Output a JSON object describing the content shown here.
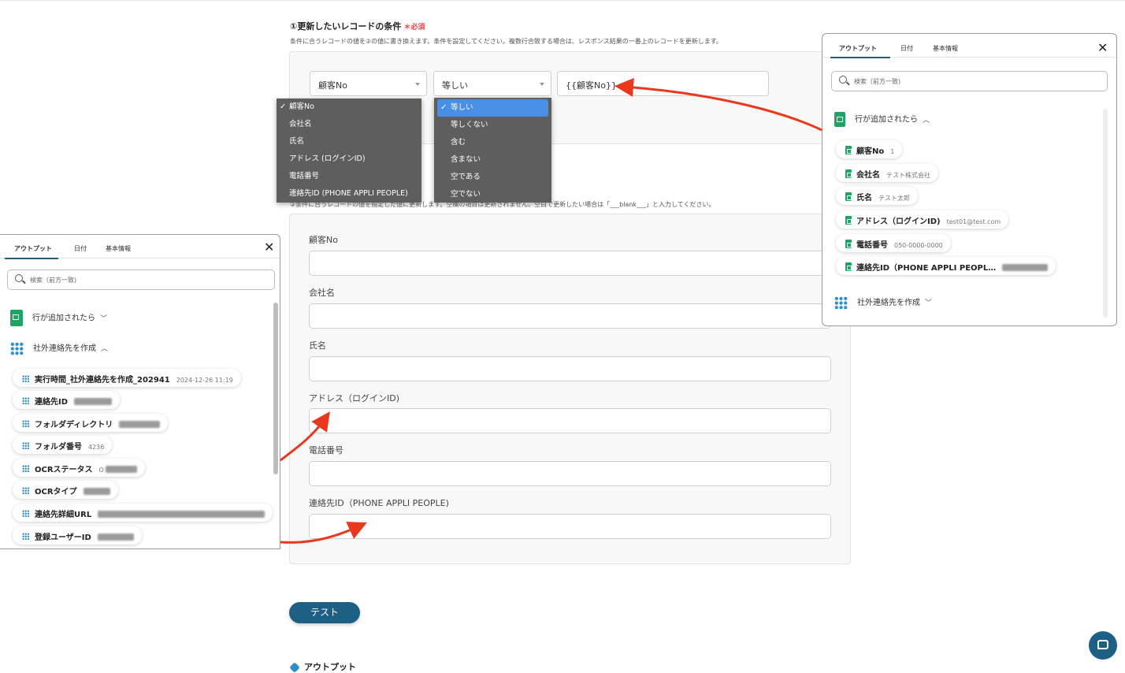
{
  "section1": {
    "title": "①更新したいレコードの条件",
    "required": "＊必須",
    "description": "条件に合うレコードの値を②の値に書き換えます。条件を設定してください。複数行合致する場合は、レスポンス結果の一番上のレコードを更新します。",
    "field_select": "顧客No",
    "operator_select": "等しい",
    "value_input": "{{顧客No}}"
  },
  "field_dropdown": {
    "options": [
      "顧客No",
      "会社名",
      "氏名",
      "アドレス (ログインID)",
      "電話番号",
      "連絡先ID (PHONE APPLI PEOPLE)"
    ],
    "selected": "顧客No"
  },
  "operator_dropdown": {
    "options": [
      "等しい",
      "等しくない",
      "含む",
      "含まない",
      "空である",
      "空でない"
    ],
    "selected": "等しい"
  },
  "section2": {
    "description": "②条件に合うレコードの値を指定した値に更新します。空欄の項目は更新されません。空白で更新したい場合は「___blank___」と入力してください。",
    "fields": [
      {
        "label": "顧客No",
        "value": ""
      },
      {
        "label": "会社名",
        "value": ""
      },
      {
        "label": "氏名",
        "value": ""
      },
      {
        "label": "アドレス（ログインID)",
        "value": ""
      },
      {
        "label": "電話番号",
        "value": ""
      },
      {
        "label": "連絡先ID（PHONE APPLI PEOPLE)",
        "value": ""
      }
    ]
  },
  "test_button": "テスト",
  "output_heading": "アウトプット",
  "left_panel": {
    "tabs": [
      "アウトプット",
      "日付",
      "基本情報"
    ],
    "search_placeholder": "検索（前方一致)",
    "group1": "行が追加されたら",
    "group2": "社外連絡先を作成",
    "items": [
      {
        "name": "実行時間_社外連絡先を作成_202941",
        "value": "2024-12-26 11:19"
      },
      {
        "name": "連絡先ID",
        "value": ""
      },
      {
        "name": "フォルダディレクトリ",
        "value": ""
      },
      {
        "name": "フォルダ番号",
        "value": "4236"
      },
      {
        "name": "OCRステータス",
        "value": "O"
      },
      {
        "name": "OCRタイプ",
        "value": ""
      },
      {
        "name": "連絡先詳細URL",
        "value": ""
      },
      {
        "name": "登録ユーザーID",
        "value": ""
      }
    ]
  },
  "right_panel": {
    "tabs": [
      "アウトプット",
      "日付",
      "基本情報"
    ],
    "search_placeholder": "検索（前方一致)",
    "group1": "行が追加されたら",
    "group2": "社外連絡先を作成",
    "items": [
      {
        "name": "顧客No",
        "value": "1"
      },
      {
        "name": "会社名",
        "value": "テスト株式会社"
      },
      {
        "name": "氏名",
        "value": "テスト太郎"
      },
      {
        "name": "アドレス（ログインID)",
        "value": "test01@test.com"
      },
      {
        "name": "電話番号",
        "value": "050-0000-0000"
      },
      {
        "name": "連絡先ID（PHONE APPLI PEOPL…",
        "value": ""
      }
    ]
  },
  "colors": {
    "accent": "#1d5f85",
    "sheet_green": "#1fa463",
    "app_blue": "#2f8fc3",
    "arrow_red": "#e8391f",
    "selected_blue": "#4a8fe7"
  }
}
